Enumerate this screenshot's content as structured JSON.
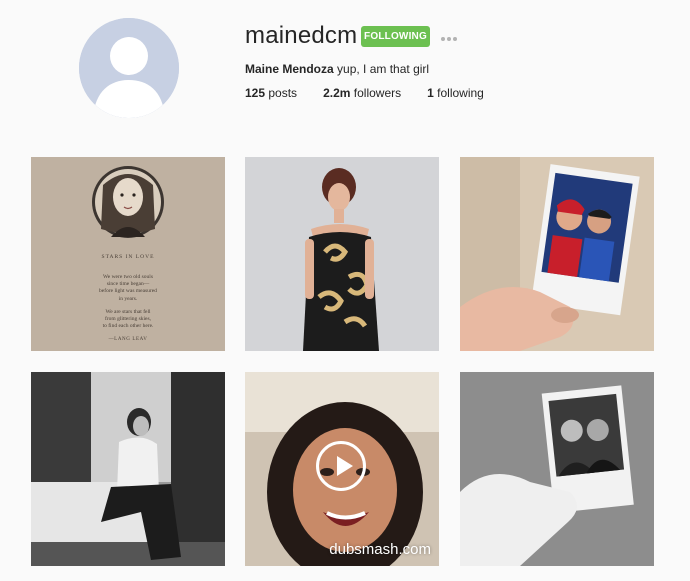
{
  "profile": {
    "username": "mainedcm",
    "follow_label": "FOLLOWING",
    "full_name": "Maine Mendoza",
    "bio": "yup, I am that girl",
    "posts_count": "125",
    "posts_label": "posts",
    "followers_count": "2.2m",
    "followers_label": "followers",
    "following_count": "1",
    "following_label": "following"
  },
  "icons": {
    "avatar": "default-avatar-silhouette",
    "more": "more-options-icon",
    "play": "play-icon"
  },
  "posts": [
    {
      "kind": "image",
      "description": "illustrated portrait",
      "poem_title": "STARS IN LOVE",
      "poem_lines": [
        "We were two old souls",
        "since time began—",
        "before light was measured",
        "in years.",
        "",
        "We are stars that fell",
        "from glittering skies,",
        "to find each other here."
      ],
      "poem_author": "—LANG LEAV"
    },
    {
      "kind": "image",
      "description": "dress portrait"
    },
    {
      "kind": "image",
      "description": "polaroid held in hand"
    },
    {
      "kind": "image",
      "description": "black and white seated portrait"
    },
    {
      "kind": "video",
      "description": "selfie video",
      "watermark": "dubsmash.com"
    },
    {
      "kind": "image",
      "description": "polaroid held in hand, grayscale"
    }
  ],
  "colors": {
    "follow_green": "#6cc051",
    "background": "#fafafa",
    "text": "#262626"
  }
}
